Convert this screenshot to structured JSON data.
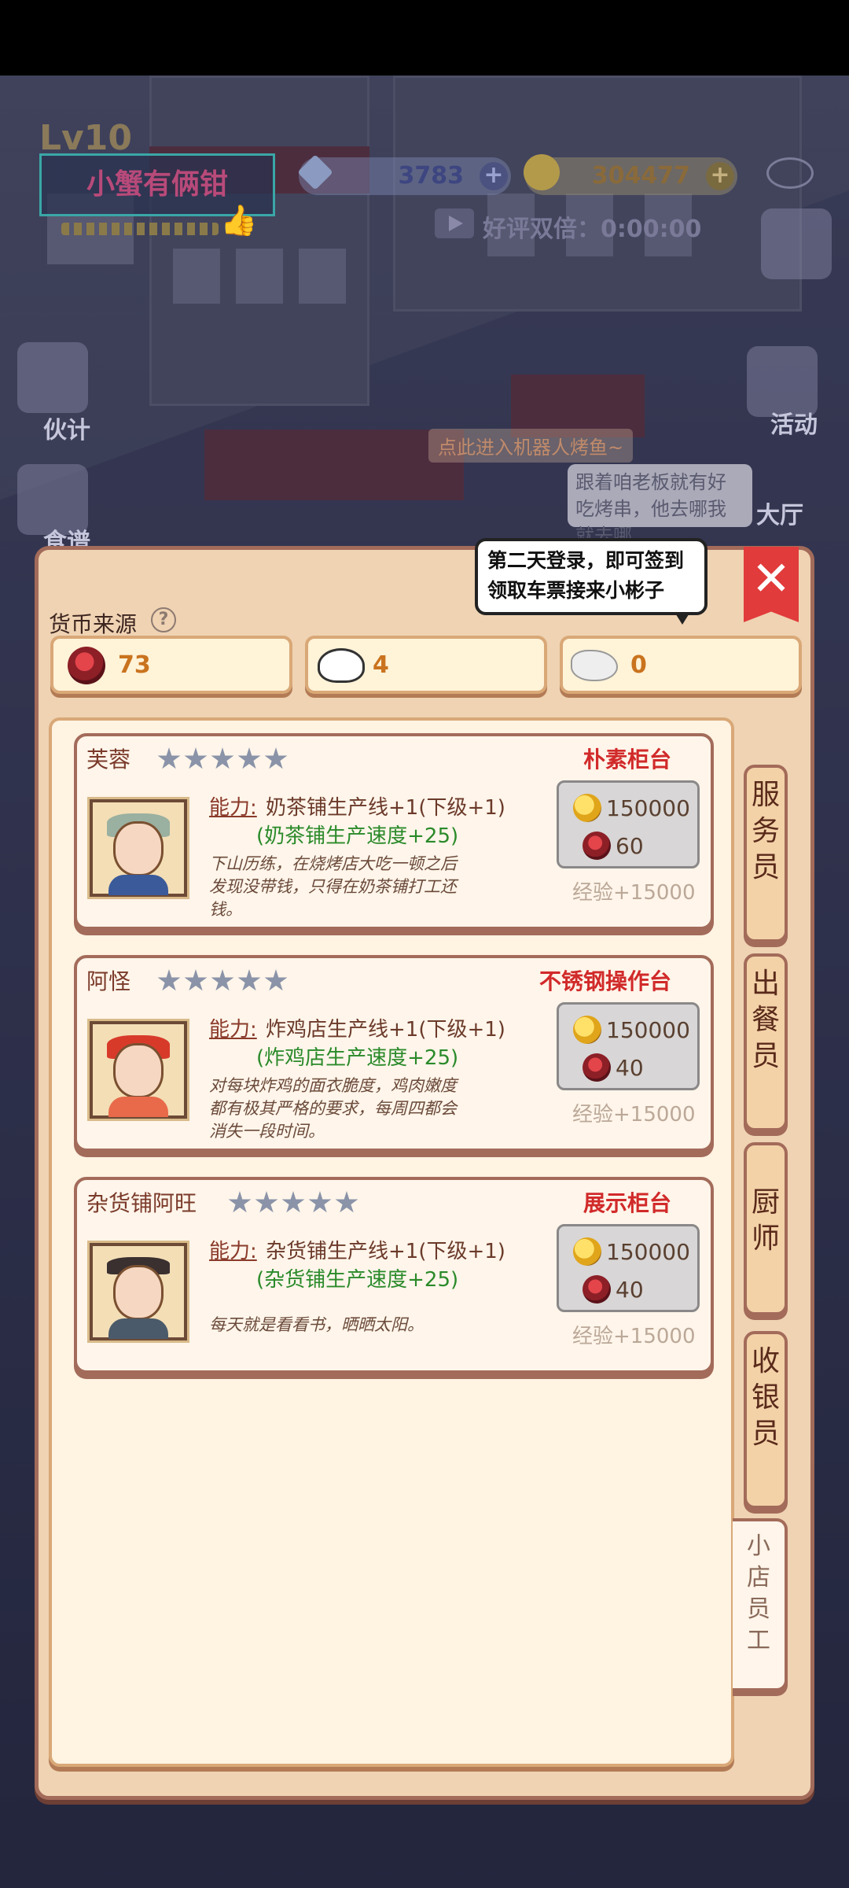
{
  "hud": {
    "level": "Lv10",
    "shop_name": "小蟹有俩钳",
    "gems": "3783",
    "gold": "304477",
    "double_reward": "好评双倍：0:00:00",
    "side_partner": "伙计",
    "side_food": "食谱",
    "side_activity": "活动",
    "side_hall": "大厅",
    "street_tip": "点此进入机器人烤鱼~",
    "speech": "跟着咱老板就有好吃烤串，他去哪我就去哪"
  },
  "tooltip": "第二天登录，即可签到领取车票接来小彬子",
  "currency": {
    "label": "货币来源",
    "items": [
      {
        "icon": "red-token-icon",
        "value": "73"
      },
      {
        "icon": "cat-mask-icon",
        "value": "4"
      },
      {
        "icon": "seal-icon",
        "value": "0"
      }
    ]
  },
  "staff": [
    {
      "name": "芙蓉",
      "stars": 5,
      "counter": "朴素柜台",
      "ability_label": "能力:",
      "ability": "奶茶铺生产线+1(下级+1)",
      "speed": "(奶茶铺生产速度+25)",
      "desc": "下山历练，在烧烤店大吃一顿之后发现没带钱，只得在奶茶铺打工还钱。",
      "gold_cost": "150000",
      "token_cost": "60",
      "exp": "经验+15000"
    },
    {
      "name": "阿怪",
      "stars": 5,
      "counter": "不锈钢操作台",
      "ability_label": "能力:",
      "ability": "炸鸡店生产线+1(下级+1)",
      "speed": "(炸鸡店生产速度+25)",
      "desc": "对每块炸鸡的面衣脆度，鸡肉嫩度都有极其严格的要求，每周四都会消失一段时间。",
      "gold_cost": "150000",
      "token_cost": "40",
      "exp": "经验+15000"
    },
    {
      "name": "杂货铺阿旺",
      "stars": 5,
      "counter": "展示柜台",
      "ability_label": "能力:",
      "ability": "杂货铺生产线+1(下级+1)",
      "speed": "(杂货铺生产速度+25)",
      "desc": "每天就是看看书，晒晒太阳。",
      "gold_cost": "150000",
      "token_cost": "40",
      "exp": "经验+15000"
    }
  ],
  "tabs": [
    "服务员",
    "出餐员",
    "厨师",
    "收银员",
    "小店员工"
  ],
  "colors": {
    "accent_red": "#d12a2a",
    "panel": "#efd3b3",
    "border": "#a36b5a",
    "green": "#2a8a2a"
  }
}
